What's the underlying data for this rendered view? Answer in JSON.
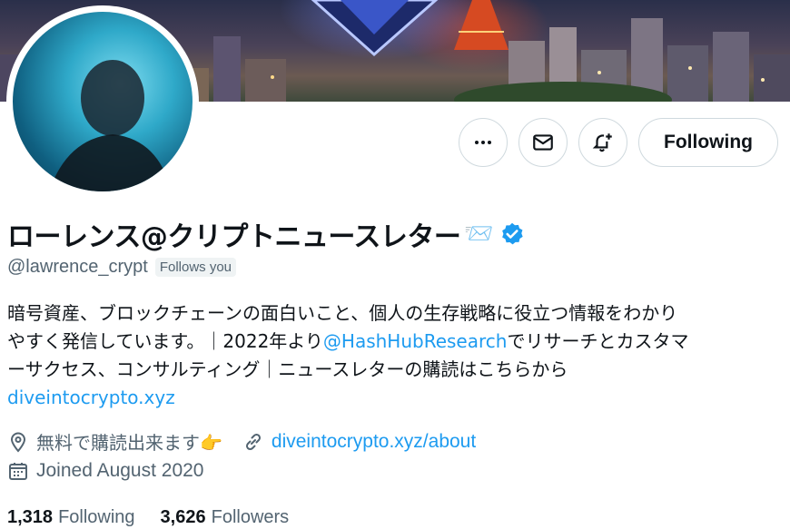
{
  "profile": {
    "display_name": "ローレンス@クリプトニュースレター",
    "name_emoji": "📨",
    "handle": "@lawrence_crypt",
    "follows_you": "Follows you",
    "bio": {
      "line1": "暗号資産、ブロックチェーンの面白いこと、個人の生存戦略に役立つ情報をわかり",
      "line2_pre": "やすく発信しています。｜2022年より",
      "line2_link": "@HashHubResearch",
      "line2_post": "でリサーチとカスタマ",
      "line3": "ーサクセス、コンサルティング｜ニュースレターの購読はこちらから",
      "line4_link": "diveintocrypto.xyz"
    },
    "location": "無料で購読出来ます👉",
    "website": "diveintocrypto.xyz/about",
    "joined": "Joined August 2020",
    "following_count": "1,318",
    "following_label": "Following",
    "followers_count": "3,626",
    "followers_label": "Followers"
  },
  "actions": {
    "following_button": "Following"
  },
  "icons": {
    "more": "more-icon",
    "message": "envelope-icon",
    "notify": "bell-plus-icon",
    "verified": "verified-badge-icon",
    "location": "location-pin-icon",
    "link": "link-icon",
    "calendar": "calendar-icon"
  },
  "colors": {
    "accent": "#1d9bf0",
    "muted": "#536471",
    "text": "#0f1419",
    "border": "#cfd9de"
  }
}
